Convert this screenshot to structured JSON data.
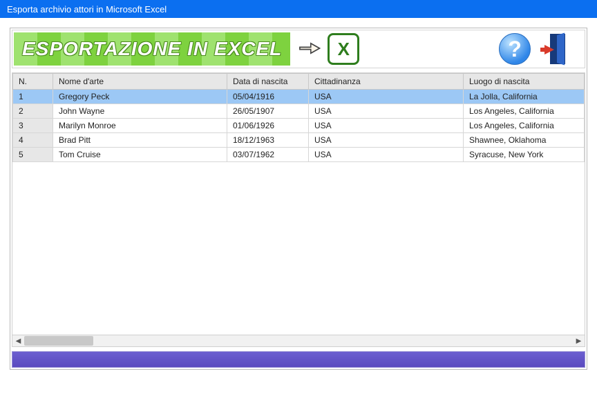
{
  "window": {
    "title": "Esporta archivio attori in Microsoft Excel"
  },
  "banner": {
    "text": "ESPORTAZIONE IN EXCEL"
  },
  "table": {
    "headers": [
      "N.",
      "Nome d'arte",
      "Data di nascita",
      "Cittadinanza",
      "Luogo di nascita"
    ],
    "rows": [
      {
        "n": "1",
        "nome": "Gregory Peck",
        "data": "05/04/1916",
        "citt": "USA",
        "luogo": "La Jolla, California",
        "selected": true
      },
      {
        "n": "2",
        "nome": "John Wayne",
        "data": "26/05/1907",
        "citt": "USA",
        "luogo": "Los Angeles, California",
        "selected": false
      },
      {
        "n": "3",
        "nome": "Marilyn Monroe",
        "data": "01/06/1926",
        "citt": "USA",
        "luogo": "Los Angeles, California",
        "selected": false
      },
      {
        "n": "4",
        "nome": "Brad Pitt",
        "data": "18/12/1963",
        "citt": "USA",
        "luogo": "Shawnee, Oklahoma",
        "selected": false
      },
      {
        "n": "5",
        "nome": "Tom Cruise",
        "data": "03/07/1962",
        "citt": "USA",
        "luogo": "Syracuse, New York",
        "selected": false
      }
    ]
  }
}
